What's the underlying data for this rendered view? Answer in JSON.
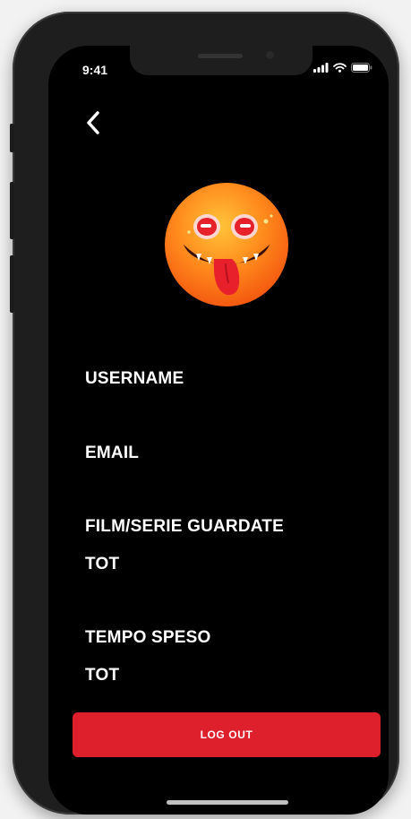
{
  "status_bar": {
    "time": "9:41"
  },
  "profile": {
    "avatar_icon": "tongue-out-emoji-icon",
    "username_label": "USERNAME",
    "email_label": "EMAIL",
    "watched_label": "FILM/SERIE GUARDATE",
    "watched_value": "TOT",
    "time_spent_label": "TEMPO SPESO",
    "time_spent_value": "TOT"
  },
  "actions": {
    "logout_label": "LOG OUT"
  },
  "colors": {
    "background": "#000000",
    "accent": "#de1f2c",
    "text": "#ffffff"
  }
}
